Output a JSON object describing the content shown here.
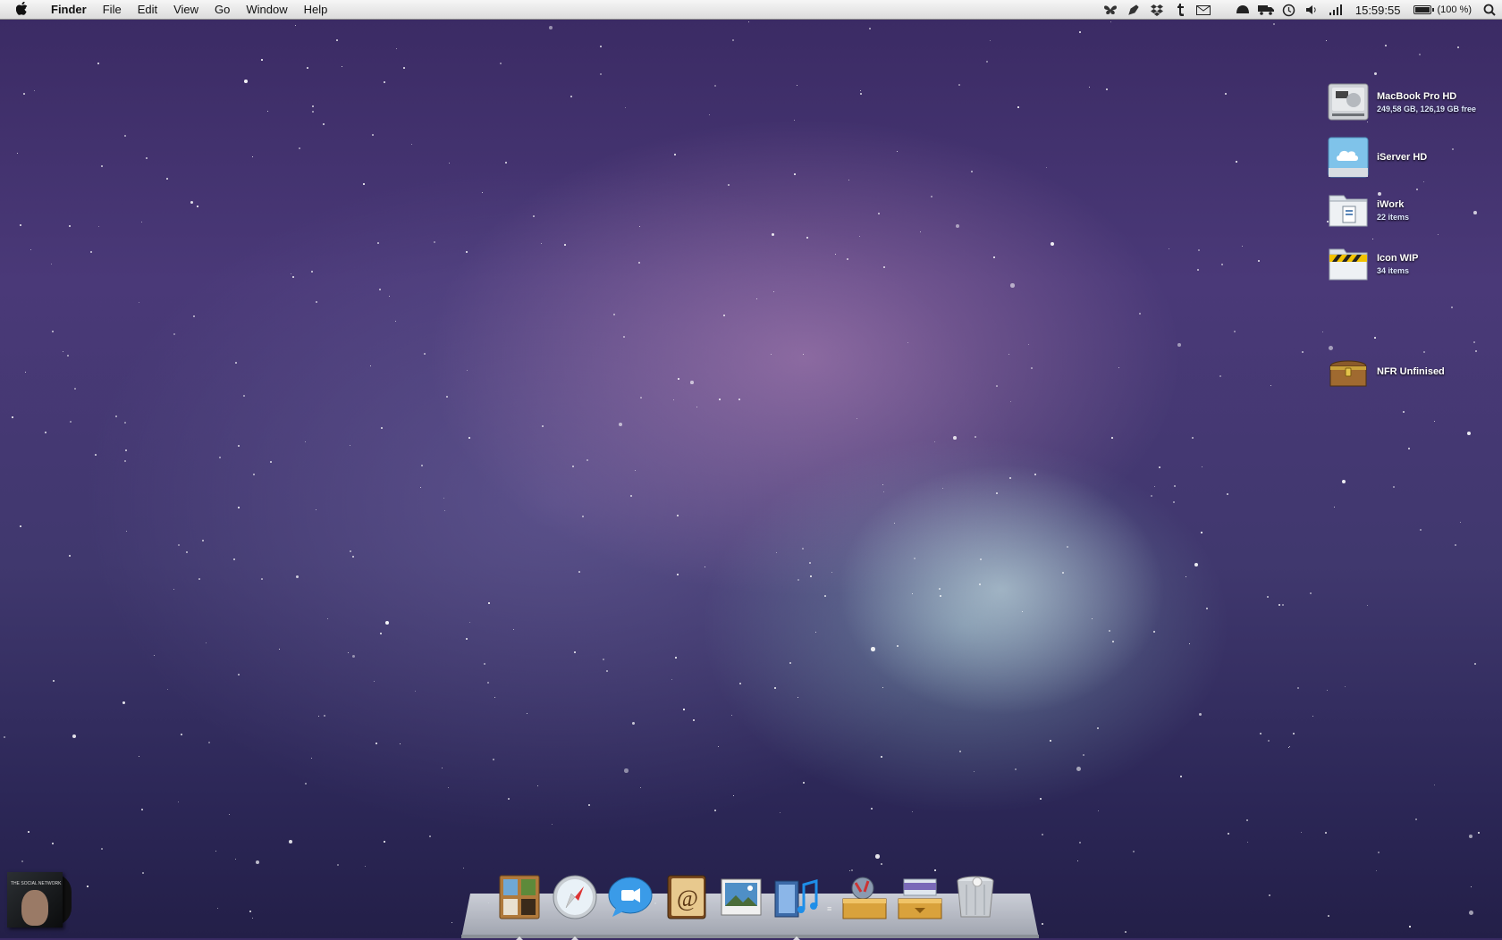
{
  "menubar": {
    "apple_icon": "apple-logo-icon",
    "app_name": "Finder",
    "menus": [
      "File",
      "Edit",
      "View",
      "Go",
      "Window",
      "Help"
    ],
    "tray_icons": [
      "butterfly-icon",
      "pen-icon",
      "dropbox-icon",
      "tumblr-icon",
      "mail-icon",
      "helmet-icon",
      "truck-icon",
      "time-machine-icon",
      "volume-icon",
      "signal-icon"
    ],
    "clock": "15:59:55",
    "battery_text": "(100 %)",
    "battery_level": 1.0,
    "spotlight_icon": "spotlight-icon"
  },
  "desktop": {
    "icons": [
      {
        "name": "MacBook Pro HD",
        "sub": "249,58 GB, 126,19 GB free",
        "icon": "hard-drive-icon"
      },
      {
        "name": "iServer HD",
        "sub": "",
        "icon": "cloud-drive-icon"
      },
      {
        "name": "iWork",
        "sub": "22 items",
        "icon": "folder-icon"
      },
      {
        "name": "Icon WIP",
        "sub": "34 items",
        "icon": "construction-folder-icon"
      },
      {
        "name": "NFR Unfinised",
        "sub": "",
        "icon": "treasure-chest-icon"
      }
    ]
  },
  "dock": {
    "items": [
      "dashboard-icon",
      "safari-icon",
      "ichat-icon",
      "address-book-icon",
      "preview-icon",
      "itunes-icon",
      "applications-stack-icon",
      "downloads-stack-icon",
      "trash-icon"
    ]
  },
  "music_widget": {
    "album_title": "THE SOCIAL NETWORK"
  },
  "colors": {
    "menubar": "#e8e8e8",
    "sky_top": "#3a2a63",
    "nebula_pink": "#be8cbe",
    "nebula_teal": "#96c8cd"
  }
}
